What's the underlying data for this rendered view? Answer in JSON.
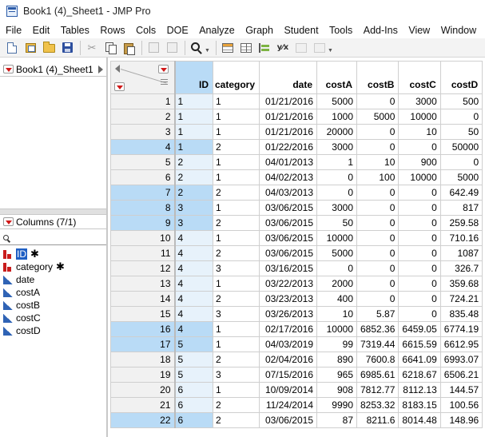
{
  "window": {
    "title": "Book1 (4)_Sheet1 - JMP Pro"
  },
  "menu": [
    "File",
    "Edit",
    "Tables",
    "Rows",
    "Cols",
    "DOE",
    "Analyze",
    "Graph",
    "Student",
    "Tools",
    "Add-Ins",
    "View",
    "Window",
    "Help"
  ],
  "toolbar": {
    "icons": [
      "new-data-table-icon",
      "new-project-icon",
      "open-folder-icon",
      "save-icon",
      "cut-icon",
      "copy-icon",
      "paste-icon",
      "disabled-icon",
      "search-icon",
      "data-table-icon",
      "grid-icon",
      "bar-chart-icon",
      "fit-y-by-x-icon",
      "graph-builder-icon",
      "script-icon"
    ]
  },
  "left_panel": {
    "table_name": "Book1 (4)_Sheet1",
    "columns_header": "Columns (7/1)",
    "search_placeholder": "",
    "columns": [
      {
        "name": "ID",
        "modeling": "nominal",
        "selected": true,
        "marked": "✱"
      },
      {
        "name": "category",
        "modeling": "nominal",
        "selected": false,
        "marked": "✱"
      },
      {
        "name": "date",
        "modeling": "continuous",
        "selected": false,
        "marked": ""
      },
      {
        "name": "costA",
        "modeling": "continuous",
        "selected": false,
        "marked": ""
      },
      {
        "name": "costB",
        "modeling": "continuous",
        "selected": false,
        "marked": ""
      },
      {
        "name": "costC",
        "modeling": "continuous",
        "selected": false,
        "marked": ""
      },
      {
        "name": "costD",
        "modeling": "continuous",
        "selected": false,
        "marked": ""
      }
    ]
  },
  "grid": {
    "headers": [
      "ID",
      "category",
      "date",
      "costA",
      "costB",
      "costC",
      "costD"
    ],
    "selected_rows": [
      4,
      7,
      8,
      9,
      16,
      17,
      22
    ],
    "rows": [
      [
        1,
        "1",
        "1",
        "01/21/2016",
        "5000",
        "0",
        "3000",
        "500"
      ],
      [
        2,
        "1",
        "1",
        "01/21/2016",
        "1000",
        "5000",
        "10000",
        "0"
      ],
      [
        3,
        "1",
        "1",
        "01/21/2016",
        "20000",
        "0",
        "10",
        "50"
      ],
      [
        4,
        "1",
        "2",
        "01/22/2016",
        "3000",
        "0",
        "0",
        "50000"
      ],
      [
        5,
        "2",
        "1",
        "04/01/2013",
        "1",
        "10",
        "900",
        "0"
      ],
      [
        6,
        "2",
        "1",
        "04/02/2013",
        "0",
        "100",
        "10000",
        "5000"
      ],
      [
        7,
        "2",
        "2",
        "04/03/2013",
        "0",
        "0",
        "0",
        "642.49"
      ],
      [
        8,
        "3",
        "1",
        "03/06/2015",
        "3000",
        "0",
        "0",
        "817"
      ],
      [
        9,
        "3",
        "2",
        "03/06/2015",
        "50",
        "0",
        "0",
        "259.58"
      ],
      [
        10,
        "4",
        "1",
        "03/06/2015",
        "10000",
        "0",
        "0",
        "710.16"
      ],
      [
        11,
        "4",
        "2",
        "03/06/2015",
        "5000",
        "0",
        "0",
        "1087"
      ],
      [
        12,
        "4",
        "3",
        "03/16/2015",
        "0",
        "0",
        "0",
        "326.7"
      ],
      [
        13,
        "4",
        "1",
        "03/22/2013",
        "2000",
        "0",
        "0",
        "359.68"
      ],
      [
        14,
        "4",
        "2",
        "03/23/2013",
        "400",
        "0",
        "0",
        "724.21"
      ],
      [
        15,
        "4",
        "3",
        "03/26/2013",
        "10",
        "5.87",
        "0",
        "835.48"
      ],
      [
        16,
        "4",
        "1",
        "02/17/2016",
        "10000",
        "6852.36",
        "6459.05",
        "6774.19"
      ],
      [
        17,
        "5",
        "1",
        "04/03/2019",
        "99",
        "7319.44",
        "6615.59",
        "6612.95"
      ],
      [
        18,
        "5",
        "2",
        "02/04/2016",
        "890",
        "7600.8",
        "6641.09",
        "6993.07"
      ],
      [
        19,
        "5",
        "3",
        "07/15/2016",
        "965",
        "6985.61",
        "6218.67",
        "6506.21"
      ],
      [
        20,
        "6",
        "1",
        "10/09/2014",
        "908",
        "7812.77",
        "8112.13",
        "144.57"
      ],
      [
        21,
        "6",
        "2",
        "11/24/2014",
        "9990",
        "8253.32",
        "8183.15",
        "100.56"
      ],
      [
        22,
        "6",
        "2",
        "03/06/2015",
        "87",
        "8211.6",
        "8014.48",
        "148.96"
      ]
    ]
  },
  "colors": {
    "selection": "#b9dbf6",
    "id_column": "#e7f2fb",
    "nominal": "#c91d1d",
    "continuous": "#2f63b5",
    "red_triangle": "#d01818"
  }
}
